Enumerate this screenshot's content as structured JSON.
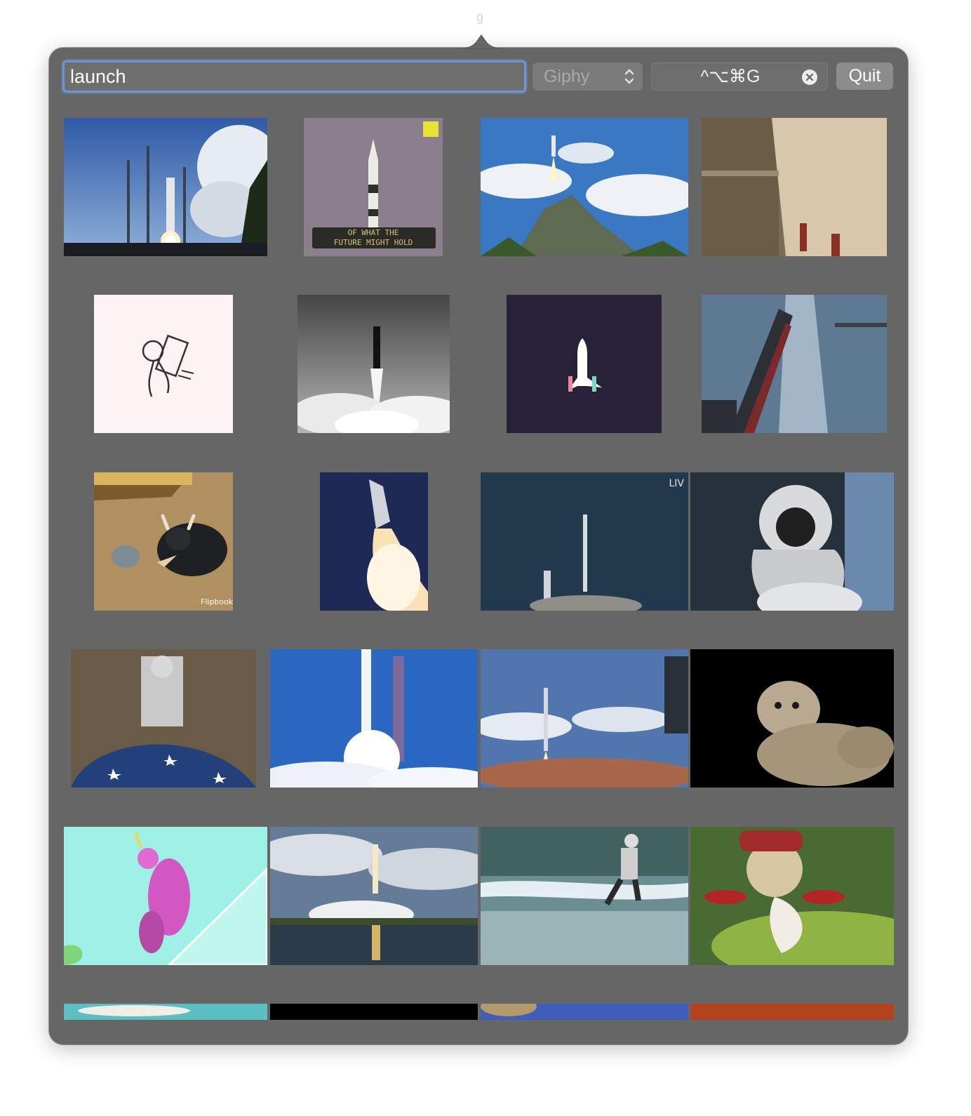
{
  "menubar": {
    "icon_glyph": "g"
  },
  "search": {
    "value": "launch",
    "placeholder": ""
  },
  "provider": {
    "selected": "Giphy",
    "icon": "chevron-up-down-icon"
  },
  "shortcut": {
    "value": "^⌥⌘G",
    "clear_icon": "clear-circle-icon"
  },
  "quit": {
    "label": "Quit"
  },
  "gifs": {
    "row1": [
      {
        "name": "rocket-launch-towers"
      },
      {
        "name": "saturn-v-rocket",
        "caption": "OF WHAT THE\nFUTURE MIGHT HOLD"
      },
      {
        "name": "rocket-from-mountain"
      },
      {
        "name": "sepia-building"
      }
    ],
    "row2": [
      {
        "name": "jetpack-doodle"
      },
      {
        "name": "shuttle-bw"
      },
      {
        "name": "shuttle-icon-dark"
      },
      {
        "name": "rocket-tower-blue"
      }
    ],
    "row3": [
      {
        "name": "bull-cartoon",
        "caption": "Flipbook"
      },
      {
        "name": "shuttle-boosters"
      },
      {
        "name": "falcon-launch-live",
        "caption": "LIV"
      },
      {
        "name": "astronaut-space"
      }
    ],
    "row4": [
      {
        "name": "stuntman-rocket"
      },
      {
        "name": "rocket-liftoff-blue"
      },
      {
        "name": "falcon-heavy"
      },
      {
        "name": "cat-cloud"
      }
    ],
    "row5": [
      {
        "name": "unicorn-cartoon"
      },
      {
        "name": "shuttle-reflection"
      },
      {
        "name": "jetpack-beach"
      },
      {
        "name": "snail-jetpack"
      }
    ],
    "row6": [
      {
        "name": "partial-sky"
      },
      {
        "name": "partial-black"
      },
      {
        "name": "partial-space"
      },
      {
        "name": "partial-red"
      }
    ]
  }
}
